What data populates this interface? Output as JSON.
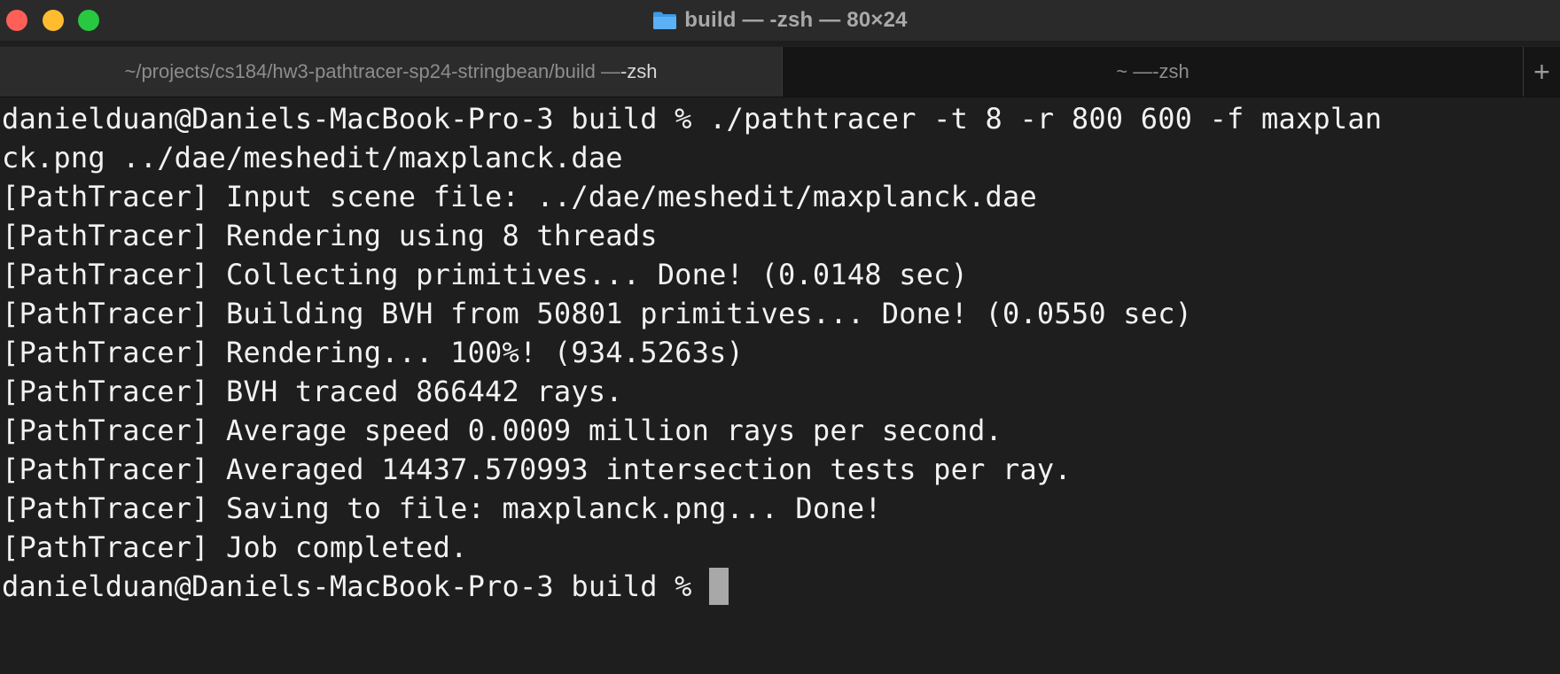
{
  "window": {
    "title": "build — -zsh — 80×24",
    "folder_icon": "folder-icon"
  },
  "tabs": [
    {
      "prefix": "~/projects/cs184/hw3-pathtracer-sp24-stringbean/build — ",
      "suffix": "-zsh",
      "active": true
    },
    {
      "prefix": "~ — ",
      "suffix": "-zsh",
      "active": false
    }
  ],
  "new_tab_label": "+",
  "terminal": {
    "lines": [
      "danielduan@Daniels-MacBook-Pro-3 build % ./pathtracer -t 8 -r 800 600 -f maxplan",
      "ck.png ../dae/meshedit/maxplanck.dae",
      "[PathTracer] Input scene file: ../dae/meshedit/maxplanck.dae",
      "[PathTracer] Rendering using 8 threads",
      "[PathTracer] Collecting primitives... Done! (0.0148 sec)",
      "[PathTracer] Building BVH from 50801 primitives... Done! (0.0550 sec)",
      "[PathTracer] Rendering... 100%! (934.5263s)",
      "[PathTracer] BVH traced 866442 rays.",
      "[PathTracer] Average speed 0.0009 million rays per second.",
      "[PathTracer] Averaged 14437.570993 intersection tests per ray.",
      "[PathTracer] Saving to file: maxplanck.png... Done!",
      "[PathTracer] Job completed."
    ],
    "prompt": "danielduan@Daniels-MacBook-Pro-3 build % "
  },
  "colors": {
    "close": "#fe5f57",
    "minimize": "#febc2e",
    "maximize": "#28c840",
    "background": "#1e1e1e",
    "text": "#f2f2f2"
  }
}
